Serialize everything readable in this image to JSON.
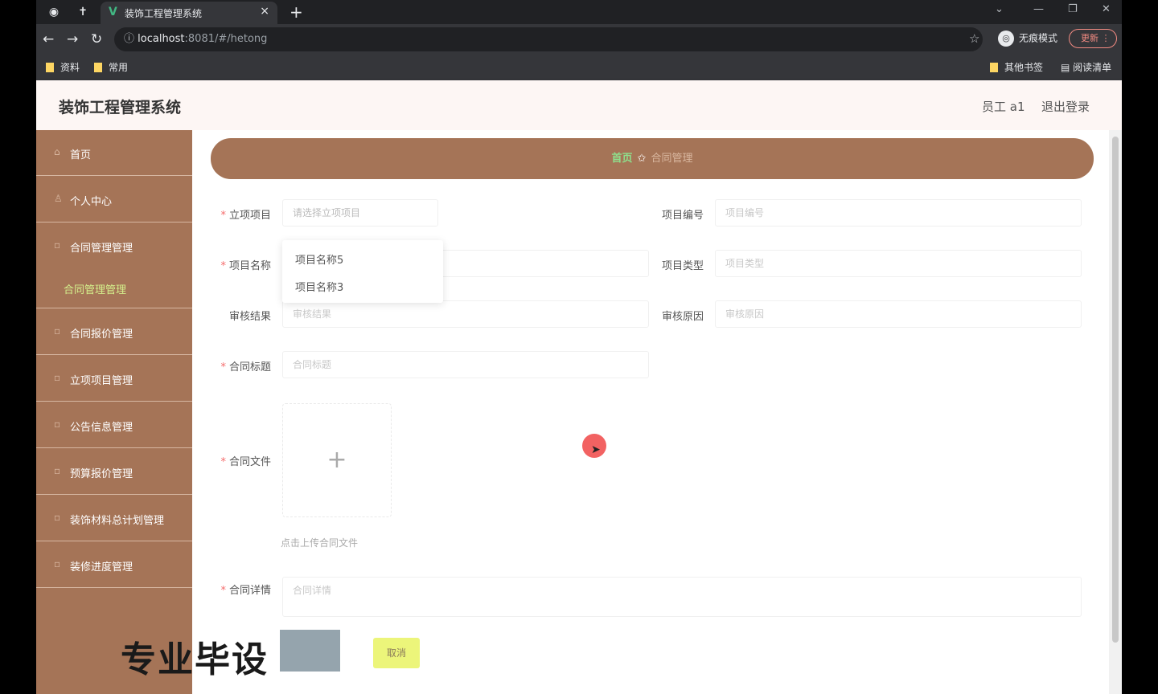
{
  "browser": {
    "tab_title": "装饰工程管理系统",
    "tab_close": "×",
    "new_tab": "+",
    "url_host": "localhost",
    "url_rest": ":8081/#/hetong",
    "profile_label": "无痕模式",
    "update_label": "更新",
    "bookmarks": [
      "资料",
      "常用"
    ],
    "bookmarks_right": [
      "其他书签",
      "阅读清单"
    ]
  },
  "header": {
    "title": "装饰工程管理系统",
    "user": "员工 a1",
    "logout": "退出登录"
  },
  "sidebar": {
    "items": [
      {
        "label": "首页",
        "icon": "home-icon"
      },
      {
        "label": "个人中心",
        "icon": "user-icon"
      },
      {
        "label": "合同管理管理",
        "icon": "doc-icon"
      },
      {
        "label": "合同管理管理",
        "icon": ""
      },
      {
        "label": "合同报价管理",
        "icon": "doc-icon"
      },
      {
        "label": "立项项目管理",
        "icon": "doc-icon"
      },
      {
        "label": "公告信息管理",
        "icon": "doc-icon"
      },
      {
        "label": "预算报价管理",
        "icon": "doc-icon"
      },
      {
        "label": "装饰材料总计划管理",
        "icon": "doc-icon"
      },
      {
        "label": "装修进度管理",
        "icon": "doc-icon"
      }
    ]
  },
  "breadcrumb": {
    "home": "首页",
    "current": "合同管理"
  },
  "form": {
    "project_label": "立项项目",
    "project_placeholder": "请选择立项项目",
    "project_no_label": "项目编号",
    "project_no_placeholder": "项目编号",
    "project_name_label": "项目名称",
    "project_type_label": "项目类型",
    "project_type_placeholder": "项目类型",
    "audit_result_label": "审核结果",
    "audit_result_placeholder": "审核结果",
    "audit_reason_label": "审核原因",
    "audit_reason_placeholder": "审核原因",
    "contract_title_label": "合同标题",
    "contract_title_placeholder": "合同标题",
    "contract_file_label": "合同文件",
    "upload_plus": "+",
    "upload_tip": "点击上传合同文件",
    "contract_detail_label": "合同详情",
    "contract_detail_placeholder": "合同详情",
    "cancel_label": "取消",
    "dropdown_options": [
      "项目名称5",
      "项目名称3"
    ]
  },
  "overlay": {
    "watermark": "专业毕设"
  },
  "colors": {
    "sidebar_bg": "#a57457",
    "accent_green": "#8ee08c",
    "required": "#f56c6c"
  }
}
